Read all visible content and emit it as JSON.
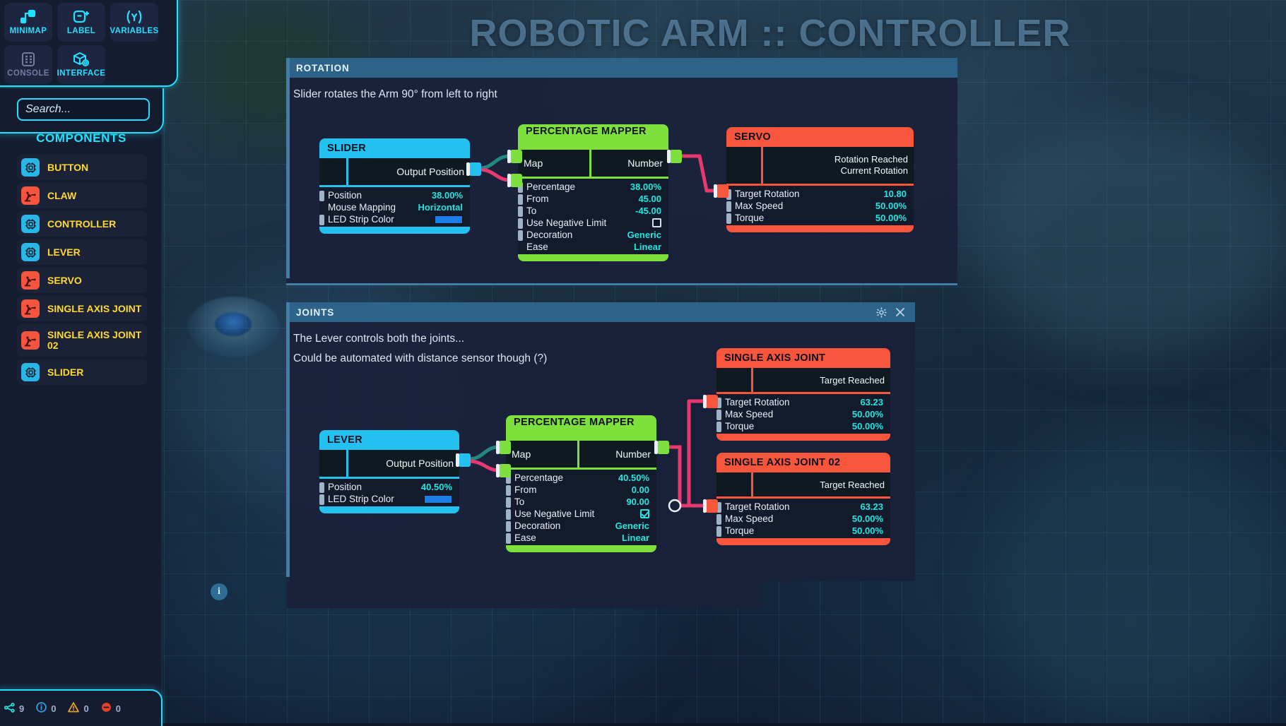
{
  "app": {
    "big_title": "ROBOTIC ARM :: CONTROLLER"
  },
  "toolbox": {
    "items": [
      {
        "label": "MINIMAP",
        "icon": "minimap-icon",
        "active": true
      },
      {
        "label": "LABEL",
        "icon": "label-plus-icon",
        "active": true
      },
      {
        "label": "VARIABLES",
        "icon": "variables-icon",
        "active": true
      },
      {
        "label": "CONSOLE",
        "icon": "console-icon",
        "active": false
      },
      {
        "label": "INTERFACE",
        "icon": "interface-icon",
        "active": true
      }
    ]
  },
  "search": {
    "value": "",
    "placeholder": "Search..."
  },
  "components": {
    "title": "COMPONENTS",
    "items": [
      {
        "label": "BUTTON",
        "icon": "chip-icon",
        "color": "blue"
      },
      {
        "label": "CLAW",
        "icon": "robot-arm-icon",
        "color": "red"
      },
      {
        "label": "CONTROLLER",
        "icon": "chip-icon",
        "color": "blue"
      },
      {
        "label": "LEVER",
        "icon": "chip-icon",
        "color": "blue"
      },
      {
        "label": "SERVO",
        "icon": "robot-arm-icon",
        "color": "red"
      },
      {
        "label": "SINGLE AXIS JOINT",
        "icon": "robot-arm-icon",
        "color": "red"
      },
      {
        "label": "SINGLE AXIS JOINT 02",
        "icon": "robot-arm-icon",
        "color": "red"
      },
      {
        "label": "SLIDER",
        "icon": "chip-icon",
        "color": "blue"
      }
    ]
  },
  "statusbar": {
    "items": [
      {
        "icon": "node-count-icon",
        "value": "9",
        "color": "#22e6e0"
      },
      {
        "icon": "info-icon",
        "value": "0",
        "color": "#2f9fd8"
      },
      {
        "icon": "warning-icon",
        "value": "0",
        "color": "#e8a02a"
      },
      {
        "icon": "error-icon",
        "value": "0",
        "color": "#e8412a"
      }
    ]
  },
  "panels": [
    {
      "id": "rotation",
      "title": "ROTATION",
      "notes": [
        "Slider rotates the Arm 90° from left to right"
      ],
      "has_controls": false
    },
    {
      "id": "joints",
      "title": "JOINTS",
      "notes": [
        "The Lever controls both the joints...",
        "Could be automated with distance sensor though (?)"
      ],
      "has_controls": true,
      "controls": [
        "gear-icon",
        "close-icon"
      ]
    }
  ],
  "nodes": {
    "slider": {
      "title": "SLIDER",
      "color": "#23c0f0",
      "output_label": "Output Position",
      "props": [
        {
          "label": "Position",
          "value": "38.00%",
          "type": "text",
          "port": true
        },
        {
          "label": "Mouse Mapping",
          "value": "Horizontal",
          "type": "text",
          "port": false
        },
        {
          "label": "LED Strip Color",
          "value": "#1a7fe8",
          "type": "color",
          "port": true
        }
      ]
    },
    "mapper_rotation": {
      "title": "PERCENTAGE MAPPER",
      "color": "#7ee03c",
      "input_label": "Map",
      "output_label": "Number",
      "props": [
        {
          "label": "Percentage",
          "value": "38.00%",
          "type": "text",
          "port": true
        },
        {
          "label": "From",
          "value": "45.00",
          "type": "text",
          "port": true
        },
        {
          "label": "To",
          "value": "-45.00",
          "type": "text",
          "port": true
        },
        {
          "label": "Use Negative Limit",
          "value": "false",
          "type": "checkbox",
          "port": true
        },
        {
          "label": "Decoration",
          "value": "Generic",
          "type": "text",
          "port": true
        },
        {
          "label": "Ease",
          "value": "Linear",
          "type": "text",
          "port": false
        }
      ]
    },
    "servo": {
      "title": "SERVO",
      "color": "#f7553c",
      "io_left": "<NONE>",
      "io_right_top": "Rotation Reached",
      "io_right_bottom": "Current Rotation",
      "props": [
        {
          "label": "Target Rotation",
          "value": "10.80",
          "type": "text",
          "port": true
        },
        {
          "label": "Max Speed",
          "value": "50.00%",
          "type": "text",
          "port": true
        },
        {
          "label": "Torque",
          "value": "50.00%",
          "type": "text",
          "port": true
        }
      ]
    },
    "lever": {
      "title": "LEVER",
      "color": "#23c0f0",
      "output_label": "Output Position",
      "props": [
        {
          "label": "Position",
          "value": "40.50%",
          "type": "text",
          "port": true
        },
        {
          "label": "LED Strip Color",
          "value": "#1a7fe8",
          "type": "color",
          "port": true
        }
      ]
    },
    "mapper_joints": {
      "title": "PERCENTAGE MAPPER",
      "color": "#7ee03c",
      "input_label": "Map",
      "output_label": "Number",
      "props": [
        {
          "label": "Percentage",
          "value": "40.50%",
          "type": "text",
          "port": true
        },
        {
          "label": "From",
          "value": "0.00",
          "type": "text",
          "port": true
        },
        {
          "label": "To",
          "value": "90.00",
          "type": "text",
          "port": true
        },
        {
          "label": "Use Negative Limit",
          "value": "true",
          "type": "checkbox",
          "port": true
        },
        {
          "label": "Decoration",
          "value": "Generic",
          "type": "text",
          "port": true
        },
        {
          "label": "Ease",
          "value": "Linear",
          "type": "text",
          "port": true
        }
      ]
    },
    "joint1": {
      "title": "SINGLE AXIS JOINT",
      "color": "#f7553c",
      "io_left": "<NONE>",
      "io_right": "Target Reached",
      "props": [
        {
          "label": "Target Rotation",
          "value": "63.23",
          "type": "text",
          "port": true
        },
        {
          "label": "Max Speed",
          "value": "50.00%",
          "type": "text",
          "port": true
        },
        {
          "label": "Torque",
          "value": "50.00%",
          "type": "text",
          "port": true
        }
      ]
    },
    "joint2": {
      "title": "SINGLE AXIS JOINT 02",
      "color": "#f7553c",
      "io_left": "<NONE>",
      "io_right": "Target Reached",
      "props": [
        {
          "label": "Target Rotation",
          "value": "63.23",
          "type": "text",
          "port": true
        },
        {
          "label": "Max Speed",
          "value": "50.00%",
          "type": "text",
          "port": true
        },
        {
          "label": "Torque",
          "value": "50.00%",
          "type": "text",
          "port": true
        }
      ]
    }
  }
}
